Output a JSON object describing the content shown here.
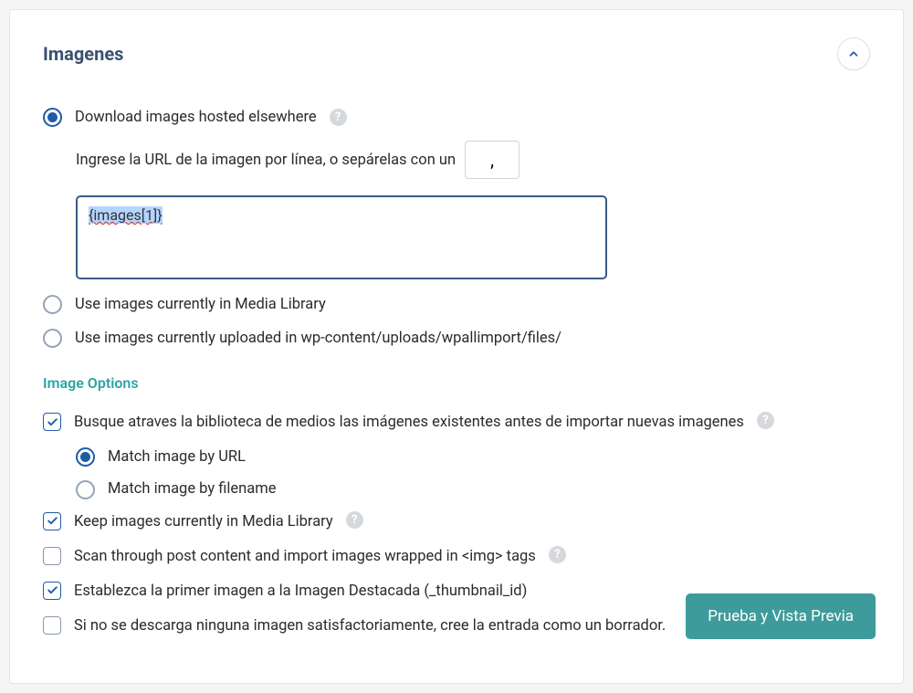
{
  "panel": {
    "title": "Imagenes"
  },
  "imageSource": {
    "download": {
      "label": "Download images hosted elsewhere",
      "instruction": "Ingrese la URL de la imagen por línea, o sepárelas con un",
      "separator": ",",
      "textarea_value": "{images[1]}"
    },
    "mediaLibrary": {
      "label": "Use images currently in Media Library"
    },
    "uploaded": {
      "label": "Use images currently uploaded in wp-content/uploads/wpallimport/files/"
    }
  },
  "imageOptions": {
    "title": "Image Options",
    "searchExisting": {
      "label": "Busque atraves la biblioteca de medios las imágenes existentes antes de importar nuevas imagenes",
      "matchByUrl": "Match image by URL",
      "matchByFilename": "Match image by filename"
    },
    "keepImages": {
      "label": "Keep images currently in Media Library"
    },
    "scanContent": {
      "label": "Scan through post content and import images wrapped in <img> tags"
    },
    "setFeatured": {
      "label": "Establezca la primer imagen a la Imagen Destacada (_thumbnail_id)"
    },
    "createDraft": {
      "label": "Si no se descarga ninguna imagen satisfactoriamente, cree la entrada como un borrador."
    }
  },
  "previewButton": "Prueba y Vista Previa"
}
